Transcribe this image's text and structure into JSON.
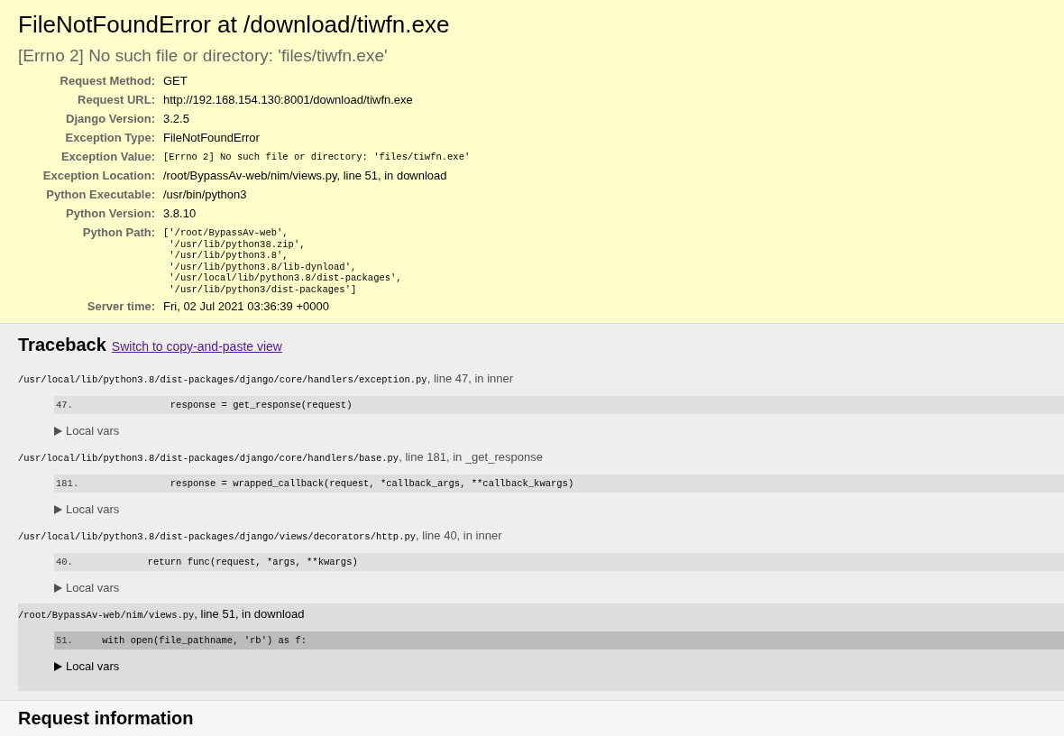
{
  "summary": {
    "title": "FileNotFoundError at /download/tiwfn.exe",
    "subtitle": "[Errno 2] No such file or directory: 'files/tiwfn.exe'",
    "meta": [
      {
        "label": "Request Method:",
        "value": "GET",
        "kind": "text"
      },
      {
        "label": "Request URL:",
        "value": "http://192.168.154.130:8001/download/tiwfn.exe",
        "kind": "text"
      },
      {
        "label": "Django Version:",
        "value": "3.2.5",
        "kind": "text"
      },
      {
        "label": "Exception Type:",
        "value": "FileNotFoundError",
        "kind": "text"
      },
      {
        "label": "Exception Value:",
        "value": "[Errno 2] No such file or directory: 'files/tiwfn.exe'",
        "kind": "code"
      },
      {
        "label": "Exception Location:",
        "value": "/root/BypassAv-web/nim/views.py, line 51, in download",
        "kind": "text"
      },
      {
        "label": "Python Executable:",
        "value": "/usr/bin/python3",
        "kind": "text"
      },
      {
        "label": "Python Version:",
        "value": "3.8.10",
        "kind": "text"
      },
      {
        "label": "Python Path:",
        "value": "['/root/BypassAv-web',\n '/usr/lib/python38.zip',\n '/usr/lib/python3.8',\n '/usr/lib/python3.8/lib-dynload',\n '/usr/local/lib/python3.8/dist-packages',\n '/usr/lib/python3/dist-packages']",
        "kind": "code"
      },
      {
        "label": "Server time:",
        "value": "Fri, 02 Jul 2021 03:36:39 +0000",
        "kind": "text"
      }
    ]
  },
  "traceback": {
    "heading": "Traceback",
    "switch_link": "Switch to copy-and-paste view",
    "frames": [
      {
        "kind": "django",
        "file": "/usr/local/lib/python3.8/dist-packages/django/core/handlers/exception.py",
        "location": ", line 47, in inner",
        "line_number": "47.",
        "code": "                response = get_response(request)",
        "local_vars": "Local vars"
      },
      {
        "kind": "django",
        "file": "/usr/local/lib/python3.8/dist-packages/django/core/handlers/base.py",
        "location": ", line 181, in _get_response",
        "line_number": "181.",
        "code": "                response = wrapped_callback(request, *callback_args, **callback_kwargs)",
        "local_vars": "Local vars"
      },
      {
        "kind": "django",
        "file": "/usr/local/lib/python3.8/dist-packages/django/views/decorators/http.py",
        "location": ", line 40, in inner",
        "line_number": "40.",
        "code": "            return func(request, *args, **kwargs)",
        "local_vars": "Local vars"
      },
      {
        "kind": "user",
        "file": "/root/BypassAv-web/nim/views.py",
        "location": ", line 51, in download",
        "line_number": "51.",
        "code": "    with open(file_pathname, 'rb') as f:",
        "local_vars": "Local vars"
      }
    ]
  },
  "request_info": {
    "heading": "Request information"
  }
}
